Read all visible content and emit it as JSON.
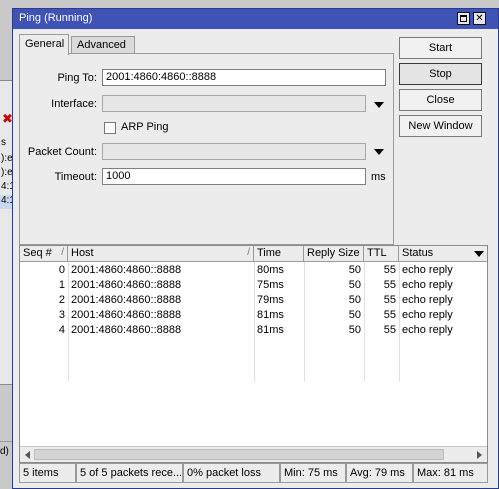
{
  "background_window": {
    "rows": [
      "s",
      "):e",
      "):e",
      "4:1",
      "4:1"
    ],
    "bottom_text": "d)"
  },
  "window": {
    "title": "Ping (Running)"
  },
  "tabs": [
    {
      "label": "General"
    },
    {
      "label": "Advanced"
    }
  ],
  "form": {
    "ping_to": {
      "label": "Ping To:",
      "value": "2001:4860:4860::8888"
    },
    "interface": {
      "label": "Interface:",
      "value": ""
    },
    "arp_ping": {
      "label": "ARP Ping",
      "checked": false
    },
    "packet_count": {
      "label": "Packet Count:",
      "value": ""
    },
    "timeout": {
      "label": "Timeout:",
      "value": "1000",
      "unit": "ms"
    }
  },
  "buttons": {
    "start": "Start",
    "stop": "Stop",
    "close": "Close",
    "new_window": "New Window"
  },
  "table": {
    "columns": [
      "Seq #",
      "Host",
      "Time",
      "Reply Size",
      "TTL",
      "Status"
    ],
    "rows": [
      {
        "seq": "0",
        "host": "2001:4860:4860::8888",
        "time": "80ms",
        "size": "50",
        "ttl": "55",
        "status": "echo reply"
      },
      {
        "seq": "1",
        "host": "2001:4860:4860::8888",
        "time": "75ms",
        "size": "50",
        "ttl": "55",
        "status": "echo reply"
      },
      {
        "seq": "2",
        "host": "2001:4860:4860::8888",
        "time": "79ms",
        "size": "50",
        "ttl": "55",
        "status": "echo reply"
      },
      {
        "seq": "3",
        "host": "2001:4860:4860::8888",
        "time": "81ms",
        "size": "50",
        "ttl": "55",
        "status": "echo reply"
      },
      {
        "seq": "4",
        "host": "2001:4860:4860::8888",
        "time": "81ms",
        "size": "50",
        "ttl": "55",
        "status": "echo reply"
      }
    ]
  },
  "statusbar": {
    "items": "5 items",
    "received": "5 of 5 packets rece...",
    "loss": "0% packet loss",
    "min": "Min: 75 ms",
    "avg": "Avg: 79 ms",
    "max": "Max: 81 ms"
  }
}
